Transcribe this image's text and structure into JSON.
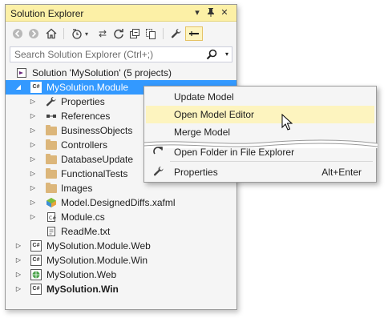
{
  "window": {
    "title": "Solution Explorer"
  },
  "search": {
    "placeholder": "Search Solution Explorer (Ctrl+;)"
  },
  "tree": {
    "solution": "Solution 'MySolution' (5 projects)",
    "module": "MySolution.Module",
    "children": [
      "Properties",
      "References",
      "BusinessObjects",
      "Controllers",
      "DatabaseUpdate",
      "FunctionalTests",
      "Images",
      "Model.DesignedDiffs.xafml",
      "Module.cs",
      "ReadMe.txt"
    ],
    "projects": [
      "MySolution.Module.Web",
      "MySolution.Module.Win",
      "MySolution.Web",
      "MySolution.Win"
    ]
  },
  "menu": {
    "update_model": "Update Model",
    "open_model_editor": "Open Model Editor",
    "merge_model": "Merge Model",
    "open_folder": "Open Folder in File Explorer",
    "properties": "Properties",
    "properties_shortcut": "Alt+Enter"
  },
  "colors": {
    "selection": "#3399ff",
    "title_bar": "#fcf0a6",
    "menu_highlight": "#fdf4bf",
    "folder": "#dcb67a"
  }
}
